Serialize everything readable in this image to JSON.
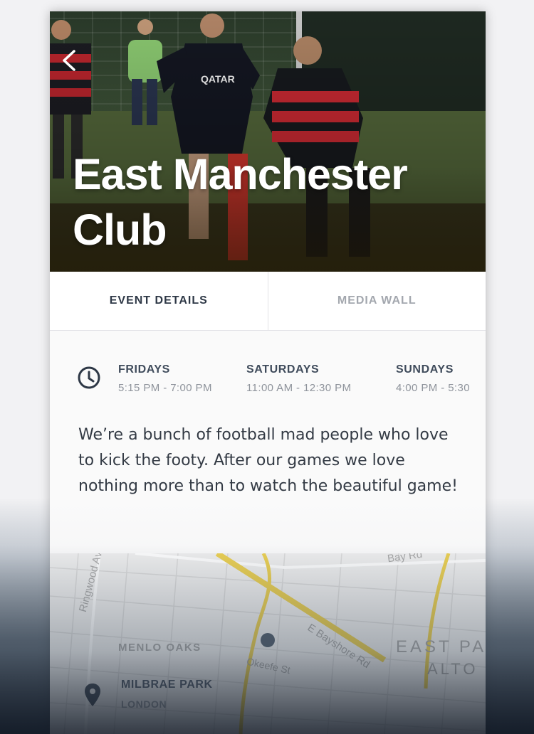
{
  "hero": {
    "title": "East Manchester Club",
    "back_icon": "chevron-left-icon"
  },
  "tabs": [
    {
      "label": "EVENT DETAILS",
      "active": true
    },
    {
      "label": "MEDIA WALL",
      "active": false
    }
  ],
  "schedule": {
    "icon": "clock-icon",
    "items": [
      {
        "day": "FRIDAYS",
        "time": "5:15 PM - 7:00 PM"
      },
      {
        "day": "SATURDAYS",
        "time": "11:00 AM - 12:30 PM"
      },
      {
        "day": "SUNDAYS",
        "time": "4:00 PM - 5:30"
      }
    ]
  },
  "description": "We’re a bunch of football mad people who love to kick the footy. After our games we love nothing more than to watch the beautiful game!",
  "map": {
    "labels": {
      "ringwood": "Ringwood Ave",
      "bay_rd": "Bay Rd",
      "bayshore": "E Bayshore Rd",
      "menlo_oaks": "MENLO OAKS",
      "east_pa": "EAST PA",
      "alto": "ALTO",
      "okeefe": "Okeefe St"
    },
    "venue": {
      "name": "MILBRAE PARK",
      "city": "LONDON"
    },
    "pin_icon": "map-pin-icon"
  },
  "colors": {
    "active_tab": "#2e3846",
    "inactive_tab": "#a3a7ae",
    "highway": "#e8c93a"
  }
}
